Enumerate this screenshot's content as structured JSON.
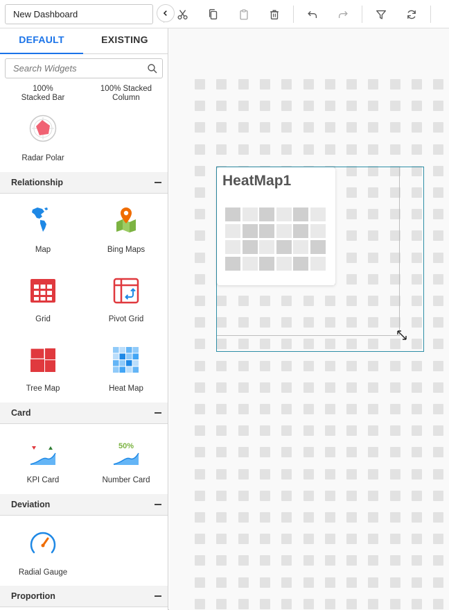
{
  "toolbar": {
    "dashboard_name": "New Dashboard",
    "buttons": [
      "cut",
      "copy",
      "paste",
      "delete",
      "undo",
      "redo",
      "filter",
      "refresh"
    ]
  },
  "sidebar": {
    "tabs": [
      {
        "label": "DEFAULT",
        "active": true
      },
      {
        "label": "EXISTING",
        "active": false
      }
    ],
    "search_placeholder": "Search Widgets",
    "top_widgets": [
      {
        "label": "100% Stacked Bar"
      },
      {
        "label": "100% Stacked Column"
      },
      {
        "label": "Radar Polar",
        "icon": "radar-polar-icon"
      }
    ],
    "sections": [
      {
        "title": "Relationship",
        "widgets": [
          {
            "label": "Map",
            "icon": "map-icon"
          },
          {
            "label": "Bing Maps",
            "icon": "bing-maps-icon"
          },
          {
            "label": "Grid",
            "icon": "grid-icon"
          },
          {
            "label": "Pivot Grid",
            "icon": "pivot-grid-icon"
          },
          {
            "label": "Tree Map",
            "icon": "tree-map-icon"
          },
          {
            "label": "Heat Map",
            "icon": "heat-map-icon"
          }
        ]
      },
      {
        "title": "Card",
        "widgets": [
          {
            "label": "KPI Card",
            "icon": "kpi-card-icon"
          },
          {
            "label": "Number Card",
            "icon": "number-card-icon",
            "badge": "50%"
          }
        ]
      },
      {
        "title": "Deviation",
        "widgets": [
          {
            "label": "Radial Gauge",
            "icon": "radial-gauge-icon"
          }
        ]
      },
      {
        "title": "Proportion",
        "widgets": []
      }
    ]
  },
  "canvas": {
    "widget_title": "HeatMap1"
  },
  "colors": {
    "accent": "#1a73e8",
    "red": "#e0393e",
    "heat_dark": "#cfcfcf",
    "heat_light": "#e9e9e9",
    "selection": "#2e8ea6"
  }
}
